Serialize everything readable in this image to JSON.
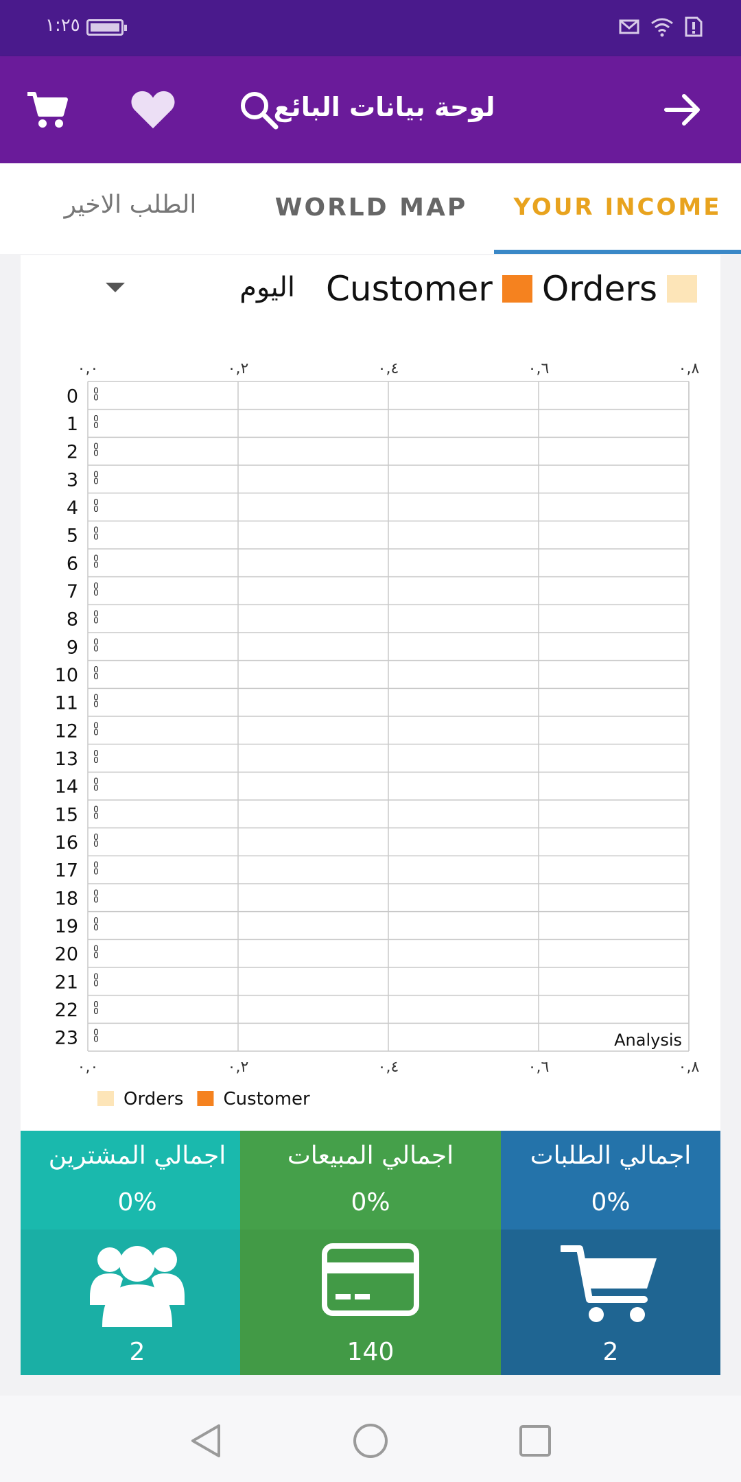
{
  "status_bar": {
    "time": "١:٢٥"
  },
  "app_bar": {
    "title": "لوحة بيانات البائع"
  },
  "tabs": [
    {
      "label": "YOUR INCOME",
      "active": true
    },
    {
      "label": "WORLD MAP",
      "active": false
    },
    {
      "label": "الطلب الاخير",
      "active": false
    }
  ],
  "chart_header": {
    "legend_orders": "Orders",
    "legend_customer": "Customer",
    "period_value": "اليوم"
  },
  "chart_data": {
    "type": "bar",
    "orientation": "horizontal",
    "categories": [
      "0",
      "1",
      "2",
      "3",
      "4",
      "5",
      "6",
      "7",
      "8",
      "9",
      "10",
      "11",
      "12",
      "13",
      "14",
      "15",
      "16",
      "17",
      "18",
      "19",
      "20",
      "21",
      "22",
      "23"
    ],
    "x_ticks": [
      "٠,٠",
      "٠,٢",
      "٠,٤",
      "٠,٦",
      "٠,٨"
    ],
    "xlim": [
      0,
      1
    ],
    "series": [
      {
        "name": "Orders",
        "color": "#fde5b8",
        "values": [
          0,
          0,
          0,
          0,
          0,
          0,
          0,
          0,
          0,
          0,
          0,
          0,
          0,
          0,
          0,
          0,
          0,
          0,
          0,
          0,
          0,
          0,
          0,
          0
        ]
      },
      {
        "name": "Customer",
        "color": "#f5821f",
        "values": [
          0,
          0,
          0,
          0,
          0,
          0,
          0,
          0,
          0,
          0,
          0,
          0,
          0,
          0,
          0,
          0,
          0,
          0,
          0,
          0,
          0,
          0,
          0,
          0
        ]
      }
    ],
    "value_label": "0",
    "description": "Analysis",
    "legend": [
      "Orders",
      "Customer"
    ],
    "legend_position": "bottom-left",
    "grid": true
  },
  "stats": [
    {
      "label": "اجمالي المشترين",
      "percent": "0%",
      "value": "2",
      "icon": "users-icon",
      "head_color": "#1ab9ad",
      "foot_color": "#1aafa5"
    },
    {
      "label": "اجمالي المبيعات",
      "percent": "0%",
      "value": "140",
      "icon": "credit-card-icon",
      "head_color": "#45a04a",
      "foot_color": "#429a46"
    },
    {
      "label": "اجمالي الطلبات",
      "percent": "0%",
      "value": "2",
      "icon": "cart-icon",
      "head_color": "#2473aa",
      "foot_color": "#1f6592"
    }
  ]
}
